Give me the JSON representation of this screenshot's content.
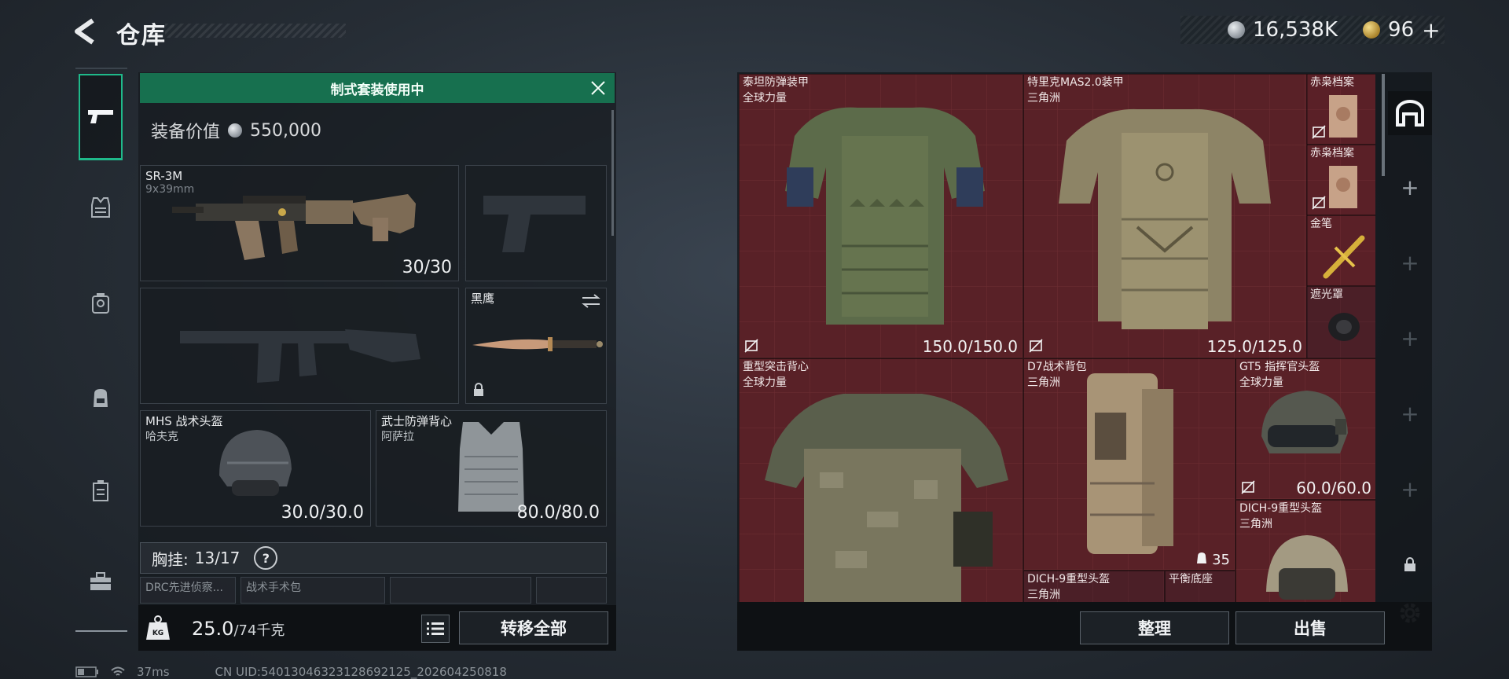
{
  "header": {
    "title": "仓库"
  },
  "currency": {
    "silver": "16,538K",
    "gold": "96",
    "add_label": "+"
  },
  "rail": {
    "tabs": [
      "weapons",
      "armor",
      "backpack-1",
      "backpack-2",
      "chest-rig",
      "toolbox"
    ]
  },
  "loadout": {
    "banner": "制式套装使用中",
    "value_label": "装备价值",
    "value": "550,000",
    "primary": {
      "name": "SR-3M",
      "caliber": "9x39mm",
      "ammo": "30/30"
    },
    "melee": {
      "name": "黑鹰"
    },
    "helmet": {
      "name": "MHS 战术头盔",
      "origin": "哈夫克",
      "durability": "30.0/30.0"
    },
    "armor": {
      "name": "武士防弹背心",
      "origin": "阿萨拉",
      "durability": "80.0/80.0"
    },
    "chest": {
      "label": "胸挂:",
      "capacity": "13/17",
      "help": "?"
    },
    "sub_slots": [
      "DRC先进侦察...",
      "战术手术包"
    ],
    "weight_value": "25.0",
    "weight_max": "/74千克",
    "weight_icon_text": "KG",
    "transfer_all": "转移全部"
  },
  "storage": {
    "items": [
      {
        "name": "泰坦防弹装甲",
        "origin": "全球力量",
        "durability": "150.0/150.0"
      },
      {
        "name": "特里克MAS2.0装甲",
        "origin": "三角洲",
        "durability": "125.0/125.0"
      },
      {
        "name": "赤枭档案"
      },
      {
        "name": "赤枭档案"
      },
      {
        "name": "金笔"
      },
      {
        "name": "遮光罩"
      },
      {
        "name": "重型突击背心",
        "origin": "全球力量"
      },
      {
        "name": "D7战术背包",
        "origin": "三角洲",
        "count": "35"
      },
      {
        "name": "GT5 指挥官头盔",
        "origin": "全球力量",
        "durability": "60.0/60.0"
      },
      {
        "name": "DICH-9重型头盔",
        "origin": "三角洲"
      },
      {
        "name": "DICH-9重型头盔",
        "origin": "三角洲"
      },
      {
        "name": "平衡底座"
      }
    ],
    "sort_label": "整理",
    "sell_label": "出售"
  },
  "status": {
    "ping": "37ms",
    "uid": "CN UID:54013046323128692125_202604250818"
  },
  "colors": {
    "accent": "#17704f",
    "grid": "#5a2127"
  }
}
